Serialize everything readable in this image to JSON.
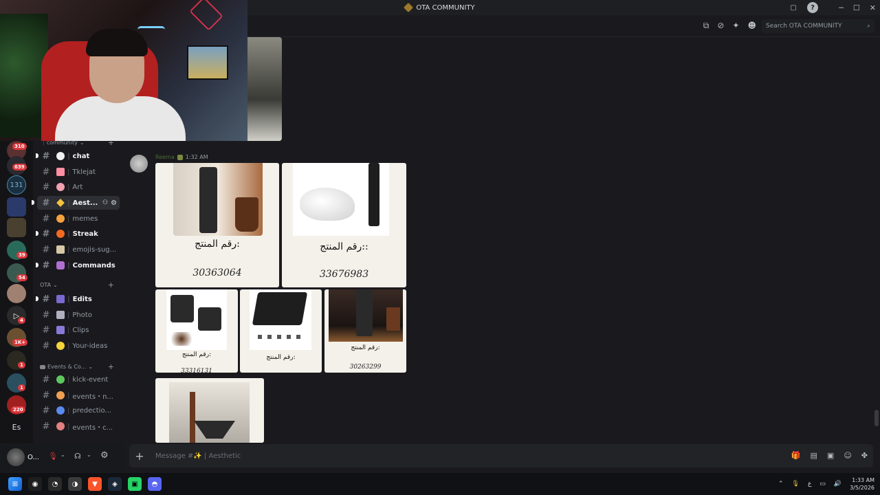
{
  "window": {
    "title": "OTA COMMUNITY"
  },
  "header": {
    "search_placeholder": "Search OTA COMMUNITY"
  },
  "servers": [
    {
      "badge": "310"
    },
    {
      "badge": "639"
    },
    {
      "label": "131"
    },
    {
      "badge": ""
    },
    {
      "badge": ""
    },
    {
      "badge": "39"
    },
    {
      "badge": "54"
    },
    {
      "badge": ""
    },
    {
      "badge": "4"
    },
    {
      "badge": "1K+"
    },
    {
      "badge": "1"
    },
    {
      "badge": "1"
    },
    {
      "badge": "220"
    },
    {
      "label": "Es"
    }
  ],
  "categories": {
    "community": "community",
    "ota": "OTA",
    "events": "Events & Co..."
  },
  "channels": [
    {
      "name": "chat",
      "emoji_color": "#f0f0f0",
      "bold": true,
      "unread": true
    },
    {
      "name": "Tklejat",
      "emoji_color": "#ff8fa3",
      "bold": false
    },
    {
      "name": "Art",
      "emoji_color": "#f0a0b0",
      "bold": false
    },
    {
      "name": "Aest...",
      "emoji_color": "#f5c33b",
      "bold": true,
      "active": true,
      "unread": true
    },
    {
      "name": "memes",
      "emoji_color": "#f7a23b",
      "bold": false
    },
    {
      "name": "Streak",
      "emoji_color": "#f46a1f",
      "bold": true,
      "unread": true
    },
    {
      "name": "emojis-sug...",
      "emoji_color": "#d8c8a8",
      "bold": false
    },
    {
      "name": "Commands",
      "emoji_color": "#b070d0",
      "bold": true,
      "unread": true
    },
    {
      "name": "Edits",
      "emoji_color": "#7a6ad0",
      "bold": true,
      "unread": true
    },
    {
      "name": "Photo",
      "emoji_color": "#b0b0c0",
      "bold": false
    },
    {
      "name": "Clips",
      "emoji_color": "#8a7ad8",
      "bold": false
    },
    {
      "name": "Your-ideas",
      "emoji_color": "#f5d33b",
      "bold": false
    },
    {
      "name": "kick-event",
      "emoji_color": "#5ec85e",
      "bold": false
    },
    {
      "name": "events・n...",
      "emoji_color": "#f0a050",
      "bold": false
    },
    {
      "name": "predectio...",
      "emoji_color": "#5a8af0",
      "bold": false
    },
    {
      "name": "events・c...",
      "emoji_color": "#e08080",
      "bold": false
    }
  ],
  "message": {
    "author": "Reema",
    "time": "1:32 AM",
    "tiles": [
      {
        "arabic": "رقم المنتج:",
        "number": "30363064"
      },
      {
        "arabic": "رقم المنتج::",
        "number": "33676983"
      },
      {
        "arabic": "رقم المنتج:",
        "number": "33316131"
      },
      {
        "arabic": "رقم المنتج:",
        "number": ""
      },
      {
        "arabic": "رقم المنتج:",
        "number": "30263299"
      },
      {
        "arabic": "",
        "number": ""
      }
    ]
  },
  "composer": {
    "placeholder": "Message #✨ | Aesthetic"
  },
  "user": {
    "name": "O..."
  },
  "taskbar": {
    "time": "1:33 AM",
    "date": "3/5/2026",
    "lang": "ع"
  }
}
